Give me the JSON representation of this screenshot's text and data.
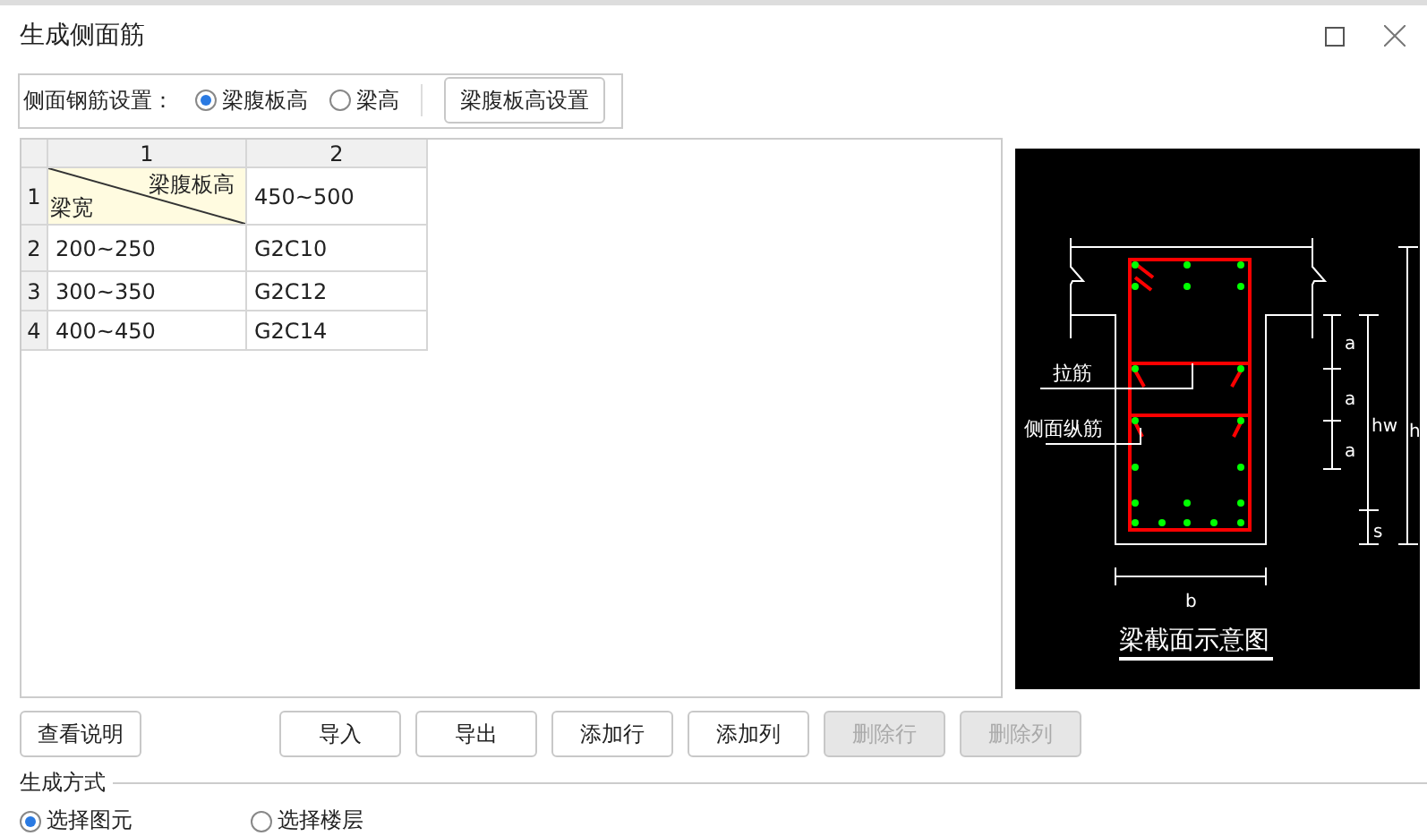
{
  "window": {
    "title": "生成侧面筋"
  },
  "side_rebar_setting": {
    "label": "侧面钢筋设置：",
    "options": [
      {
        "label": "梁腹板高",
        "selected": true
      },
      {
        "label": "梁高",
        "selected": false
      }
    ],
    "button": "梁腹板高设置"
  },
  "table": {
    "columns": [
      "1",
      "2"
    ],
    "rows": [
      {
        "number": "1",
        "cells": [
          {
            "kind": "diagonal",
            "top": "梁腹板高",
            "bottom": "梁宽"
          },
          {
            "kind": "text",
            "text": "450~500"
          }
        ]
      },
      {
        "number": "2",
        "cells": [
          {
            "kind": "text",
            "text": "200~250"
          },
          {
            "kind": "text",
            "text": "G2C10"
          }
        ]
      },
      {
        "number": "3",
        "cells": [
          {
            "kind": "text",
            "text": "300~350"
          },
          {
            "kind": "text",
            "text": "G2C12"
          }
        ]
      },
      {
        "number": "4",
        "cells": [
          {
            "kind": "text",
            "text": "400~450"
          },
          {
            "kind": "text",
            "text": "G2C14"
          }
        ]
      }
    ]
  },
  "diagram": {
    "tie_label": "拉筋",
    "side_bar_label": "侧面纵筋",
    "a_labels": [
      "a",
      "a",
      "a"
    ],
    "hw": "hw",
    "s": "s",
    "h": "h",
    "b": "b",
    "caption": "梁截面示意图"
  },
  "help_button": {
    "label": "查看说明",
    "disabled": false
  },
  "actions": [
    {
      "label": "导入",
      "disabled": false
    },
    {
      "label": "导出",
      "disabled": false
    },
    {
      "label": "添加行",
      "disabled": false
    },
    {
      "label": "添加列",
      "disabled": false
    },
    {
      "label": "删除行",
      "disabled": true
    },
    {
      "label": "删除列",
      "disabled": true
    }
  ],
  "generation_mode": {
    "title": "生成方式",
    "options": [
      {
        "label": "选择图元",
        "selected": true
      },
      {
        "label": "选择楼层",
        "selected": false
      }
    ]
  }
}
